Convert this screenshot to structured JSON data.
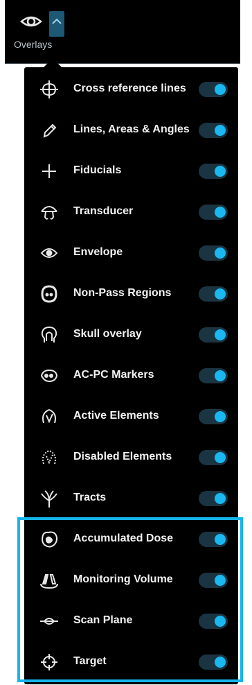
{
  "overlays_button": {
    "label": "Overlays",
    "icon": "eye-icon",
    "dropdown_icon": "chevron-up-icon",
    "accent": "#1d5875"
  },
  "toggle_color": "#1ab8f0",
  "highlight_color": "#15b5ec",
  "items": [
    {
      "label": "Cross reference lines",
      "icon": "crosshair-lines-icon",
      "enabled": true
    },
    {
      "label": "Lines, Areas & Angles",
      "icon": "pencil-icon",
      "enabled": true
    },
    {
      "label": "Fiducials",
      "icon": "plus-icon",
      "enabled": true
    },
    {
      "label": "Transducer",
      "icon": "transducer-icon",
      "enabled": true
    },
    {
      "label": "Envelope",
      "icon": "envelope-icon",
      "enabled": true
    },
    {
      "label": "Non-Pass Regions",
      "icon": "non-pass-regions-icon",
      "enabled": true
    },
    {
      "label": "Skull overlay",
      "icon": "skull-icon",
      "enabled": true
    },
    {
      "label": "AC-PC Markers",
      "icon": "ac-pc-markers-icon",
      "enabled": true
    },
    {
      "label": "Active Elements",
      "icon": "active-elements-icon",
      "enabled": true
    },
    {
      "label": "Disabled Elements",
      "icon": "disabled-elements-icon",
      "enabled": true
    },
    {
      "label": "Tracts",
      "icon": "tracts-icon",
      "enabled": true
    },
    {
      "label": "Accumulated Dose",
      "icon": "accumulated-dose-icon",
      "enabled": true
    },
    {
      "label": "Monitoring Volume",
      "icon": "monitoring-volume-icon",
      "enabled": true
    },
    {
      "label": "Scan Plane",
      "icon": "scan-plane-icon",
      "enabled": true
    },
    {
      "label": "Target",
      "icon": "target-icon",
      "enabled": true
    }
  ]
}
